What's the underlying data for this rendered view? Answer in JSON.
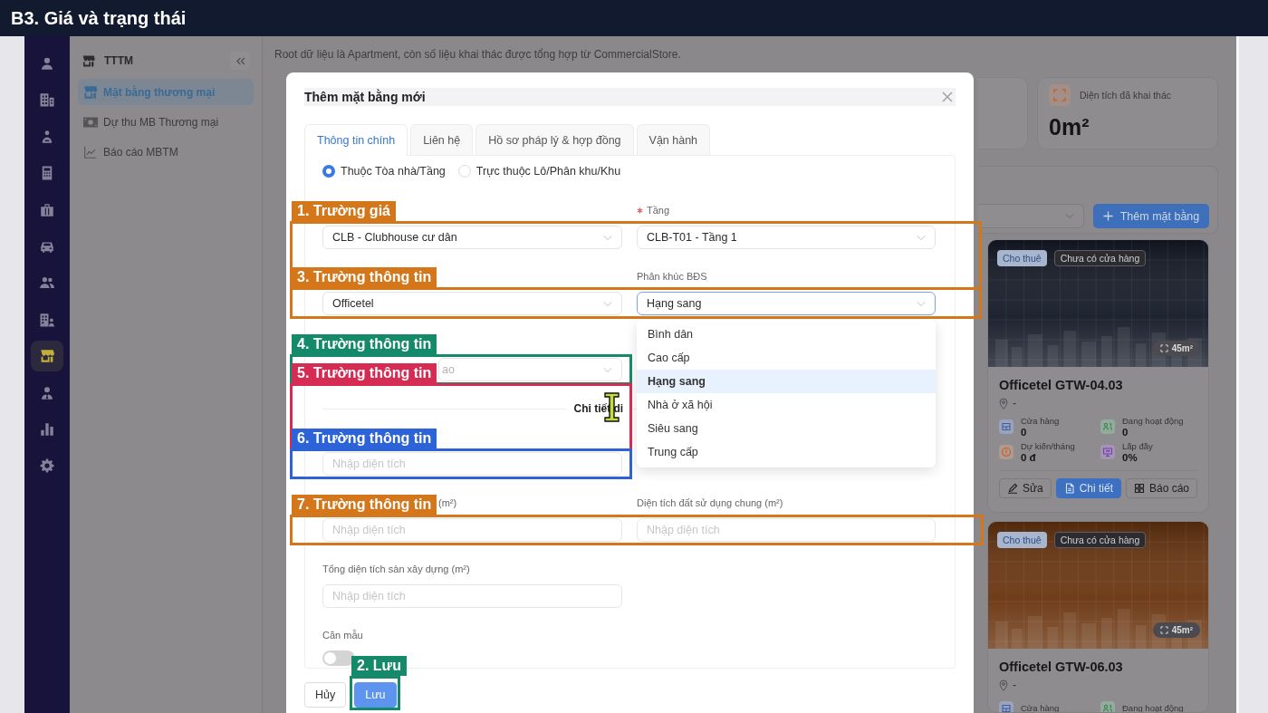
{
  "banner": {
    "title": "B3. Giá và trạng thái"
  },
  "rail": {
    "items": [
      {
        "selected": false
      },
      {
        "selected": false
      },
      {
        "selected": false
      },
      {
        "selected": false
      },
      {
        "selected": false
      },
      {
        "selected": false
      },
      {
        "selected": false
      },
      {
        "selected": false
      },
      {
        "selected": true
      },
      {
        "selected": false
      },
      {
        "selected": false
      },
      {
        "selected": false
      }
    ]
  },
  "sidebar": {
    "title": "TTTM",
    "items": [
      {
        "label": "Mặt bằng thương mại",
        "selected": true
      },
      {
        "label": "Dự thu MB Thương mại",
        "selected": false
      },
      {
        "label": "Báo cáo MBTM",
        "selected": false
      }
    ]
  },
  "page": {
    "note": "Root dữ liệu là Apartment, còn số liệu khai thác được tổng hợp từ CommercialStore.",
    "stat_card": {
      "label": "Diện tích đã khai thác",
      "value": "0m²"
    },
    "add_button": "Thêm mặt bằng",
    "cards": [
      {
        "tags": [
          {
            "label": "Cho thuê",
            "kind": "status"
          },
          {
            "label": "Chưa có cửa hàng",
            "kind": "store"
          }
        ],
        "area": "45m²",
        "color": "#141a27",
        "title": "Officetel GTW-04.03",
        "location": "-",
        "stats": [
          {
            "label": "Cửa hàng",
            "value": "0"
          },
          {
            "label": "Đang hoạt động",
            "value": "0"
          },
          {
            "label": "Dự kiến/tháng",
            "value": "0 đ"
          },
          {
            "label": "Lấp đầy",
            "value": "0%"
          }
        ],
        "actions": [
          {
            "label": "Sửa",
            "kind": "default"
          },
          {
            "label": "Chi tiết",
            "kind": "primary"
          },
          {
            "label": "Báo cáo",
            "kind": "default"
          }
        ]
      },
      {
        "tags": [
          {
            "label": "Cho thuê",
            "kind": "status"
          },
          {
            "label": "Chưa có cửa hàng",
            "kind": "store"
          }
        ],
        "area": "45m²",
        "color": "#6a3510",
        "title": "Officetel GTW-06.03",
        "location": "-",
        "stats": [
          {
            "label": "Cửa hàng"
          },
          {
            "label": "Đang hoạt động"
          }
        ]
      }
    ]
  },
  "modal": {
    "title": "Thêm mặt bằng mới",
    "tabs": [
      {
        "label": "Thông tin chính",
        "selected": true
      },
      {
        "label": "Liên hệ",
        "selected": false
      },
      {
        "label": "Hồ sơ pháp lý & hợp đồng",
        "selected": false
      },
      {
        "label": "Vận hành",
        "selected": false
      }
    ],
    "placement": [
      {
        "label": "Thuộc Tòa nhà/Tầng",
        "selected": true
      },
      {
        "label": "Trực thuộc Lô/Phân khu/Khu",
        "selected": false
      }
    ],
    "rows": [
      {
        "kind": "fields",
        "left": {
          "kind": "select",
          "value": "CLB - Clubhouse cư dân"
        },
        "right": {
          "kind": "select",
          "label": "Tầng",
          "required": true,
          "value": "CLB-T01 - Tầng 1"
        }
      },
      {
        "kind": "fields",
        "left": {
          "kind": "select",
          "value": "Officetel"
        },
        "right": {
          "kind": "select",
          "label": "Phân khúc BĐS",
          "value": "Hạng sang",
          "focused": true,
          "expanded": true,
          "options": [
            {
              "label": "Bình dân",
              "selected": false
            },
            {
              "label": "Cao cấp",
              "selected": false
            },
            {
              "label": "Hạng sang",
              "selected": true
            },
            {
              "label": "Nhà ở xã hội",
              "selected": false
            },
            {
              "label": "Siêu sang",
              "selected": false
            },
            {
              "label": "Trung cấp",
              "selected": false
            }
          ]
        }
      },
      {
        "kind": "fields",
        "left": {
          "kind": "select",
          "placeholder": "ao"
        }
      },
      {
        "kind": "divider",
        "text": "Chi tiết di"
      },
      {
        "kind": "fields",
        "left": {
          "kind": "input",
          "placeholder": "Nhập diện tích"
        }
      },
      {
        "kind": "fields",
        "left": {
          "kind": "input",
          "label": "(m²)",
          "placeholder": "Nhập diện tích"
        },
        "right": {
          "kind": "input",
          "label": "Diện tích đất sử dụng chung (m²)",
          "placeholder": "Nhập diện tích"
        }
      },
      {
        "kind": "fields",
        "left": {
          "kind": "input",
          "label": "Tổng diện tích sàn xây dựng (m²)",
          "placeholder": "Nhập diện tích"
        }
      },
      {
        "kind": "fields",
        "left": {
          "kind": "switch",
          "label": "Căn mẫu",
          "on": false
        }
      }
    ],
    "buttons": [
      {
        "label": "Hủy",
        "kind": "default"
      },
      {
        "label": "Lưu",
        "kind": "primary"
      }
    ]
  },
  "annotations": [
    {
      "label": "1. Trường giá",
      "color": "#d4771b"
    },
    {
      "label": "3. Trường thông tin",
      "color": "#d4771b"
    },
    {
      "label": "4. Trường thông tin",
      "color": "#148a6a"
    },
    {
      "label": "5. Trường thông tin",
      "color": "#d62b52"
    },
    {
      "label": "6. Trường thông tin",
      "color": "#2d63d8"
    },
    {
      "label": "7. Trường thông tin",
      "color": "#d4771b"
    },
    {
      "label": "2. Lưu",
      "color": "#148a6a"
    }
  ]
}
